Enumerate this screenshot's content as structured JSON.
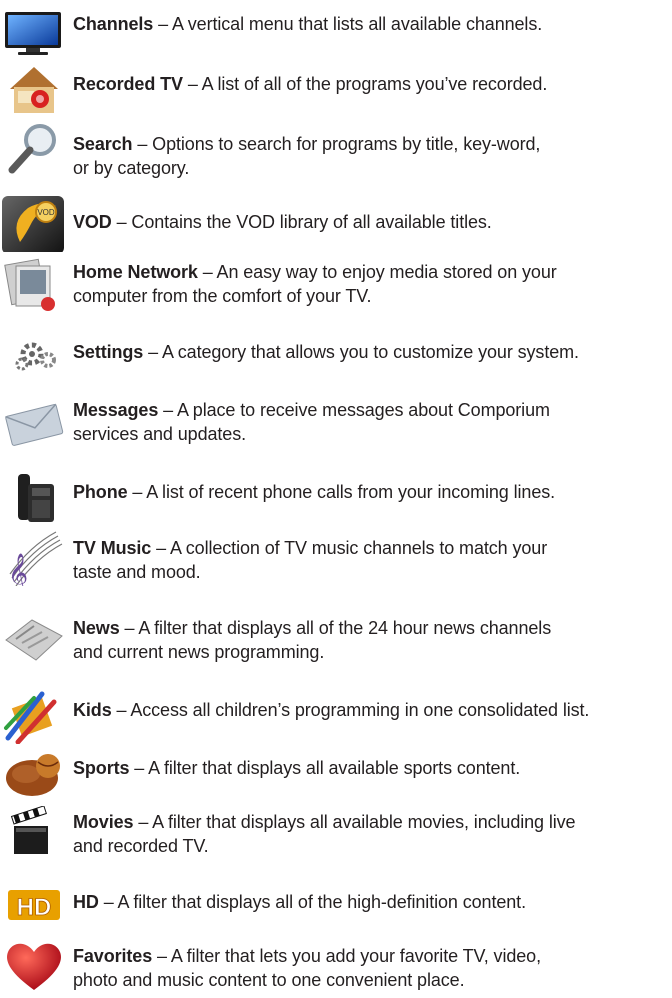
{
  "entries": [
    {
      "icon": "tv-screen-icon",
      "term": "Channels",
      "desc_lines": [
        " – A vertical menu that lists all available channels."
      ]
    },
    {
      "icon": "house-record-icon",
      "term": "Recorded TV",
      "desc_lines": [
        " – A list of all of the programs you’ve recorded."
      ]
    },
    {
      "icon": "magnifier-icon",
      "term": "Search",
      "desc_lines": [
        " – Options to search for programs by title, key-word,",
        "or by category."
      ]
    },
    {
      "icon": "vod-icon",
      "term": "VOD",
      "desc_lines": [
        " – Contains the VOD library of all available titles."
      ]
    },
    {
      "icon": "photo-stack-icon",
      "term": "Home Network",
      "desc_lines": [
        " – An easy way to enjoy media stored on your",
        "computer from the comfort of your TV."
      ]
    },
    {
      "icon": "gears-icon",
      "term": "Settings",
      "desc_lines": [
        " – A category that allows you to customize your system."
      ]
    },
    {
      "icon": "envelope-icon",
      "term": "Messages",
      "desc_lines": [
        " – A place to receive messages about Comporium",
        "services and updates."
      ]
    },
    {
      "icon": "phone-icon",
      "term": "Phone",
      "desc_lines": [
        " – A list of recent phone calls from your incoming lines."
      ]
    },
    {
      "icon": "music-staff-icon",
      "term": "TV Music",
      "desc_lines": [
        " – A collection of TV music channels to match your",
        "taste and mood."
      ]
    },
    {
      "icon": "newspaper-icon",
      "term": "News",
      "desc_lines": [
        " – A filter that displays all of the 24 hour news channels",
        "and current news programming."
      ]
    },
    {
      "icon": "crayons-icon",
      "term": "Kids",
      "desc_lines": [
        " – Access all children’s programming in one consolidated list."
      ]
    },
    {
      "icon": "sports-balls-icon",
      "term": "Sports",
      "desc_lines": [
        " – A filter that displays all available sports content."
      ]
    },
    {
      "icon": "clapperboard-icon",
      "term": "Movies",
      "desc_lines": [
        " – A filter that displays all available movies, including live",
        "and recorded TV."
      ]
    },
    {
      "icon": "hd-icon",
      "term": "HD",
      "desc_lines": [
        " – A filter that displays all of the high-definition content."
      ]
    },
    {
      "icon": "heart-icon",
      "term": "Favorites",
      "desc_lines": [
        " – A filter that lets you add your favorite TV, video,",
        "photo and music content to one convenient place."
      ]
    }
  ]
}
